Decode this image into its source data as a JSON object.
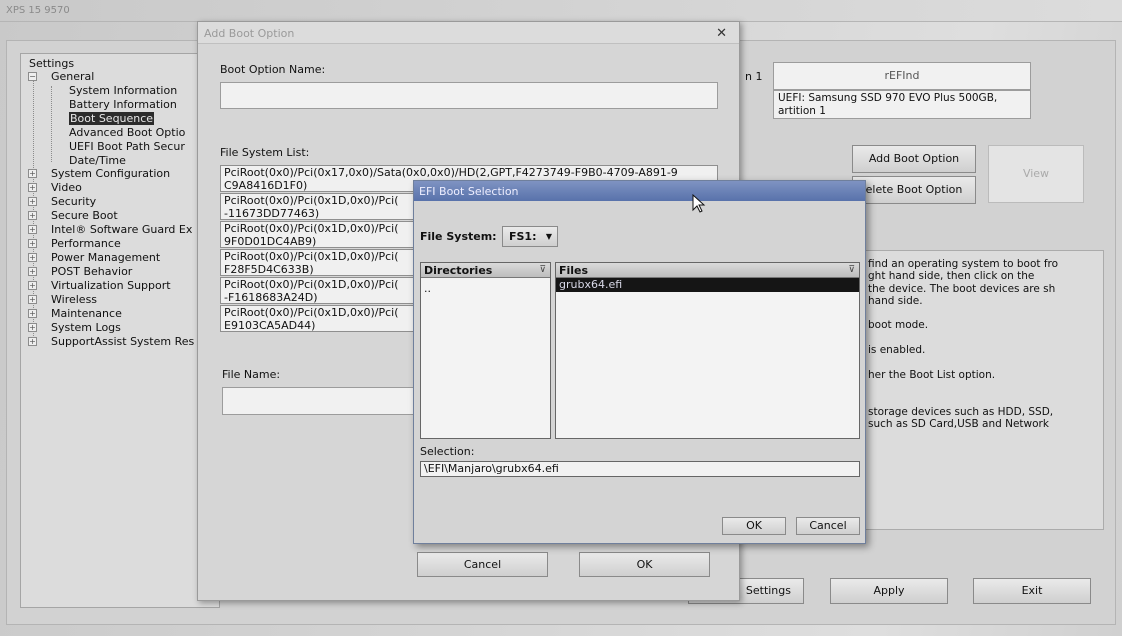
{
  "app": {
    "title": "XPS 15 9570"
  },
  "tree": {
    "root": "Settings",
    "items": [
      {
        "label": "General",
        "level": 1
      },
      {
        "label": "System Information",
        "level": 2
      },
      {
        "label": "Battery Information",
        "level": 2
      },
      {
        "label": "Boot Sequence",
        "level": 2,
        "selected": true
      },
      {
        "label": "Advanced Boot Optio",
        "level": 2
      },
      {
        "label": "UEFI Boot Path Secur",
        "level": 2
      },
      {
        "label": "Date/Time",
        "level": 2
      },
      {
        "label": "System Configuration",
        "level": 1
      },
      {
        "label": "Video",
        "level": 1
      },
      {
        "label": "Security",
        "level": 1
      },
      {
        "label": "Secure Boot",
        "level": 1
      },
      {
        "label": "Intel® Software Guard Ex",
        "level": 1
      },
      {
        "label": "Performance",
        "level": 1
      },
      {
        "label": "Power Management",
        "level": 1
      },
      {
        "label": "POST Behavior",
        "level": 1
      },
      {
        "label": "Virtualization Support",
        "level": 1
      },
      {
        "label": "Wireless",
        "level": 1
      },
      {
        "label": "Maintenance",
        "level": 1
      },
      {
        "label": "System Logs",
        "level": 1
      },
      {
        "label": "SupportAssist System Res",
        "level": 1
      }
    ]
  },
  "boot_panel": {
    "option_label": "n 1",
    "option_value": "rEFInd",
    "device_line1": "UEFI: Samsung SSD 970 EVO Plus 500GB,",
    "device_line2": "artition 1",
    "add_button": "Add Boot Option",
    "delete_button": "elete Boot Option",
    "view_button": "View",
    "help_lines": [
      "find an operating system to boot fro",
      "ght hand side, then click on the",
      "the device. The boot devices are sh",
      "hand side.",
      "",
      "boot mode.",
      "",
      "is enabled.",
      "",
      "her the Boot List option.",
      "",
      "",
      "storage devices such as HDD, SSD,",
      "such as SD Card,USB and Network"
    ]
  },
  "bottom_bar": {
    "restore": "Settings",
    "apply": "Apply",
    "exit": "Exit"
  },
  "add_dialog": {
    "title": "Add Boot Option",
    "name_label": "Boot Option Name:",
    "name_value": "",
    "fs_label": "File System List:",
    "fs_items": [
      "PciRoot(0x0)/Pci(0x17,0x0)/Sata(0x0,0x0)/HD(2,GPT,F4273749-F9B0-4709-A891-9\nC9A8416D1F0)",
      "PciRoot(0x0)/Pci(0x1D,0x0)/Pci(\n-11673DD77463)",
      "PciRoot(0x0)/Pci(0x1D,0x0)/Pci(\n9F0D01DC4AB9)",
      "PciRoot(0x0)/Pci(0x1D,0x0)/Pci(\nF28F5D4C633B)",
      "PciRoot(0x0)/Pci(0x1D,0x0)/Pci(\n-F1618683A24D)",
      "PciRoot(0x0)/Pci(0x1D,0x0)/Pci(\nE9103CA5AD44)"
    ],
    "file_name_label": "File Name:",
    "file_name_value": "",
    "cancel": "Cancel",
    "ok": "OK"
  },
  "efi_dialog": {
    "title": "EFI Boot Selection",
    "fs_label": "File System:",
    "fs_value": "FS1:",
    "dirs_header": "Directories",
    "dirs": [
      ".."
    ],
    "files_header": "Files",
    "files": [
      "grubx64.efi"
    ],
    "selection_label": "Selection:",
    "selection_value": "\\EFI\\Manjaro\\grubx64.efi",
    "ok": "OK",
    "cancel": "Cancel"
  }
}
